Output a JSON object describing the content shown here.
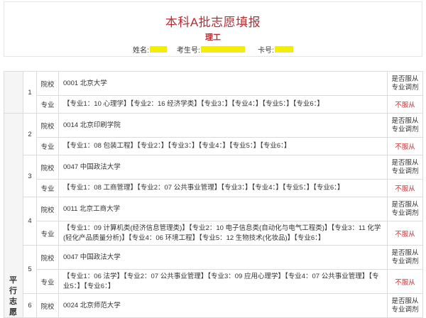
{
  "header": {
    "title": "本科A批志愿填报",
    "subtitle": "理工",
    "name_label": "姓名:",
    "exam_no_label": "考生号:",
    "card_no_label": "卡号:"
  },
  "table": {
    "side_label": [
      "平",
      "行",
      "志",
      "愿"
    ],
    "type_school": "院校",
    "type_major": "专业",
    "obey_header": "是否服从\n专业调剂",
    "not_obey": "不服从",
    "entries": [
      {
        "index": "1",
        "school": "0001 北京大学",
        "majors": "【专业1：10 心理学】【专业2：16 经济学类】【专业3：】【专业4：】【专业5：】【专业6：】"
      },
      {
        "index": "2",
        "school": "0014 北京印刷学院",
        "majors": "【专业1：08 包装工程】【专业2：】【专业3：】【专业4：】【专业5：】【专业6：】"
      },
      {
        "index": "3",
        "school": "0047 中国政法大学",
        "majors": "【专业1：08 工商管理】【专业2：07 公共事业管理】【专业3：】【专业4：】【专业5：】【专业6：】"
      },
      {
        "index": "4",
        "school": "0011 北京工商大学",
        "majors": "【专业1：09 计算机类(经济信息管理类)】【专业2：10 电子信息类(自动化与电气工程类)】【专业3：11 化学(轻化产品质量分析)】【专业4：06 环境工程】【专业5：12 生物技术(化妆品)】【专业6：】"
      },
      {
        "index": "5",
        "school": "0047 中国政法大学",
        "majors": "【专业1：06 法学】【专业2：07 公共事业管理】【专业3：09 应用心理学】【专业4：07 公共事业管理】【专业5：】【专业6：】"
      },
      {
        "index": "6",
        "school": "0024 北京师范大学"
      }
    ]
  }
}
